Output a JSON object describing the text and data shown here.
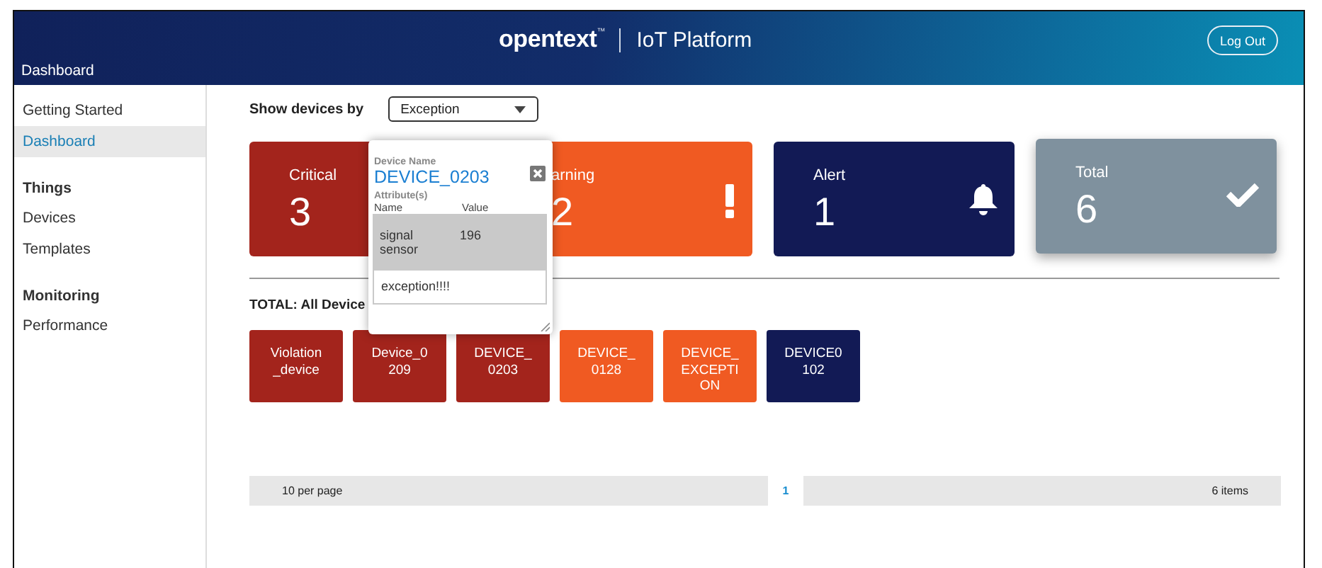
{
  "header": {
    "section_title": "Dashboard",
    "logo": "opentext",
    "trademark": "™",
    "product": "IoT Platform",
    "logout": "Log Out"
  },
  "sidebar": {
    "items": [
      {
        "kind": "link",
        "label": "Getting Started",
        "selected": false
      },
      {
        "kind": "link",
        "label": "Dashboard",
        "selected": true
      },
      {
        "kind": "heading",
        "label": "Things"
      },
      {
        "kind": "link",
        "label": "Devices",
        "selected": false
      },
      {
        "kind": "link",
        "label": "Templates",
        "selected": false
      },
      {
        "kind": "heading",
        "label": "Monitoring"
      },
      {
        "kind": "link",
        "label": "Performance",
        "selected": false
      }
    ]
  },
  "filter": {
    "label": "Show devices by",
    "value": "Exception"
  },
  "status_cards": [
    {
      "kind": "critical",
      "label": "Critical",
      "count": "3",
      "color": "#a3241c"
    },
    {
      "kind": "warning",
      "label": "arning",
      "count": "2",
      "color": "#f05a22"
    },
    {
      "kind": "alert",
      "label": "Alert",
      "count": "1",
      "color": "#121a55"
    },
    {
      "kind": "total",
      "label": "Total",
      "count": "6",
      "color": "#7f919e"
    }
  ],
  "total_heading": "TOTAL: All Device",
  "devices": [
    {
      "name": "Violation\n_device",
      "color": "#a3241c"
    },
    {
      "name": "Device_0\n209",
      "color": "#a3241c"
    },
    {
      "name": "DEVICE_\n0203",
      "color": "#a3241c"
    },
    {
      "name": "DEVICE_\n0128",
      "color": "#f05a22"
    },
    {
      "name": "DEVICE_\nEXCEPTI\nON",
      "color": "#f05a22"
    },
    {
      "name": "DEVICE0\n102",
      "color": "#121a55"
    }
  ],
  "pagination": {
    "page_size": "10 per page",
    "current_page": "1",
    "item_count": "6 items"
  },
  "popup": {
    "name_label": "Device Name",
    "device_name": "DEVICE_0203",
    "attributes_label": "Attribute(s)",
    "columns": [
      "Name",
      "Value"
    ],
    "rows": [
      {
        "name": "signal\nsensor",
        "value": "196"
      }
    ],
    "message": "exception!!!!"
  }
}
